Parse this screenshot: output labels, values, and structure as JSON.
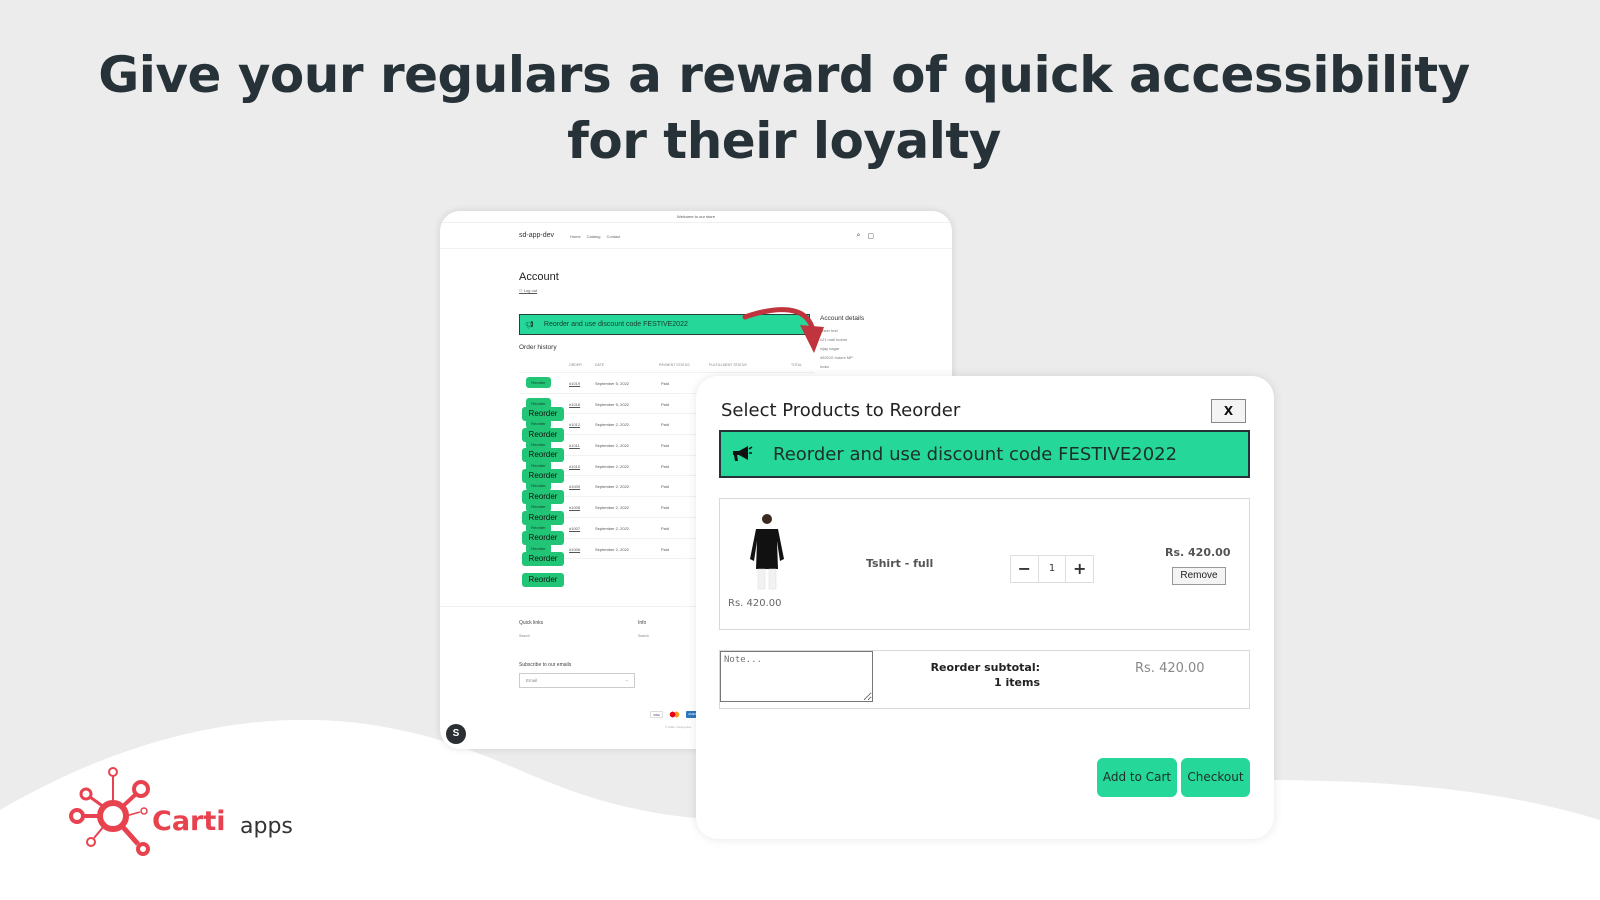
{
  "headline": {
    "line1": "Give your regulars a reward of quick accessibility",
    "line2": "for their loyalty"
  },
  "store": {
    "announcement": "Welcome to our store",
    "brand": "sd-app-dev",
    "nav": [
      "Home",
      "Catalog",
      "Contact"
    ],
    "icons": {
      "search": "search-icon",
      "cart": "cart-icon"
    },
    "account_title": "Account",
    "logout": "Log out",
    "banner_text": "Reorder and use discount code FESTIVE2022",
    "order_history_title": "Order history",
    "columns": [
      "ORDER",
      "DATE",
      "PAYMENT STATUS",
      "FULFILLMENT STATUS",
      "TOTAL"
    ],
    "reorder_label": "Reorder",
    "orders": [
      {
        "order": "#1019",
        "date": "September 5, 2022",
        "payment": "Paid"
      },
      {
        "order": "#1018",
        "date": "September 5, 2022",
        "payment": "Paid"
      },
      {
        "order": "#1012",
        "date": "September 2, 2022",
        "payment": "Paid"
      },
      {
        "order": "#1011",
        "date": "September 2, 2022",
        "payment": "Paid"
      },
      {
        "order": "#1010",
        "date": "September 2, 2022",
        "payment": "Paid"
      },
      {
        "order": "#1009",
        "date": "September 2, 2022",
        "payment": "Paid"
      },
      {
        "order": "#1008",
        "date": "September 2, 2022",
        "payment": "Paid"
      },
      {
        "order": "#1007",
        "date": "September 2, 2022",
        "payment": "Paid"
      },
      {
        "order": "#1006",
        "date": "September 2, 2022",
        "payment": "Paid"
      }
    ],
    "account_details": {
      "title": "Account details",
      "lines": [
        "tester test",
        "c21 mall Indore",
        "vijay nagar",
        "452010 Indore MP",
        "India"
      ]
    },
    "footer": {
      "quick_links": "Quick links",
      "quick_links_item": "Search",
      "info": "Info",
      "info_item": "Search",
      "subscribe": "Subscribe to our emails",
      "email_placeholder": "Email",
      "payments": [
        "VISA",
        "MC",
        "AMEX"
      ],
      "copyright": "© 2022, sd-app-dev"
    }
  },
  "modal": {
    "title": "Select Products to Reorder",
    "close_label": "X",
    "banner_text": "Reorder and use discount code FESTIVE2022",
    "item": {
      "name": "Tshirt - full",
      "unit_price": "Rs. 420.00",
      "line_price": "Rs. 420.00",
      "quantity": "1",
      "remove_label": "Remove"
    },
    "note_placeholder": "Note...",
    "subtotal_label": "Reorder subtotal:",
    "items_count": "1 items",
    "subtotal_value": "Rs. 420.00",
    "add_to_cart_label": "Add to Cart",
    "checkout_label": "Checkout"
  },
  "logo": {
    "name": "Carti",
    "suffix": "apps"
  },
  "colors": {
    "accent": "#26d79a",
    "reorder_green": "#22c476",
    "brand_red": "#e8424f",
    "heading": "#263238"
  }
}
